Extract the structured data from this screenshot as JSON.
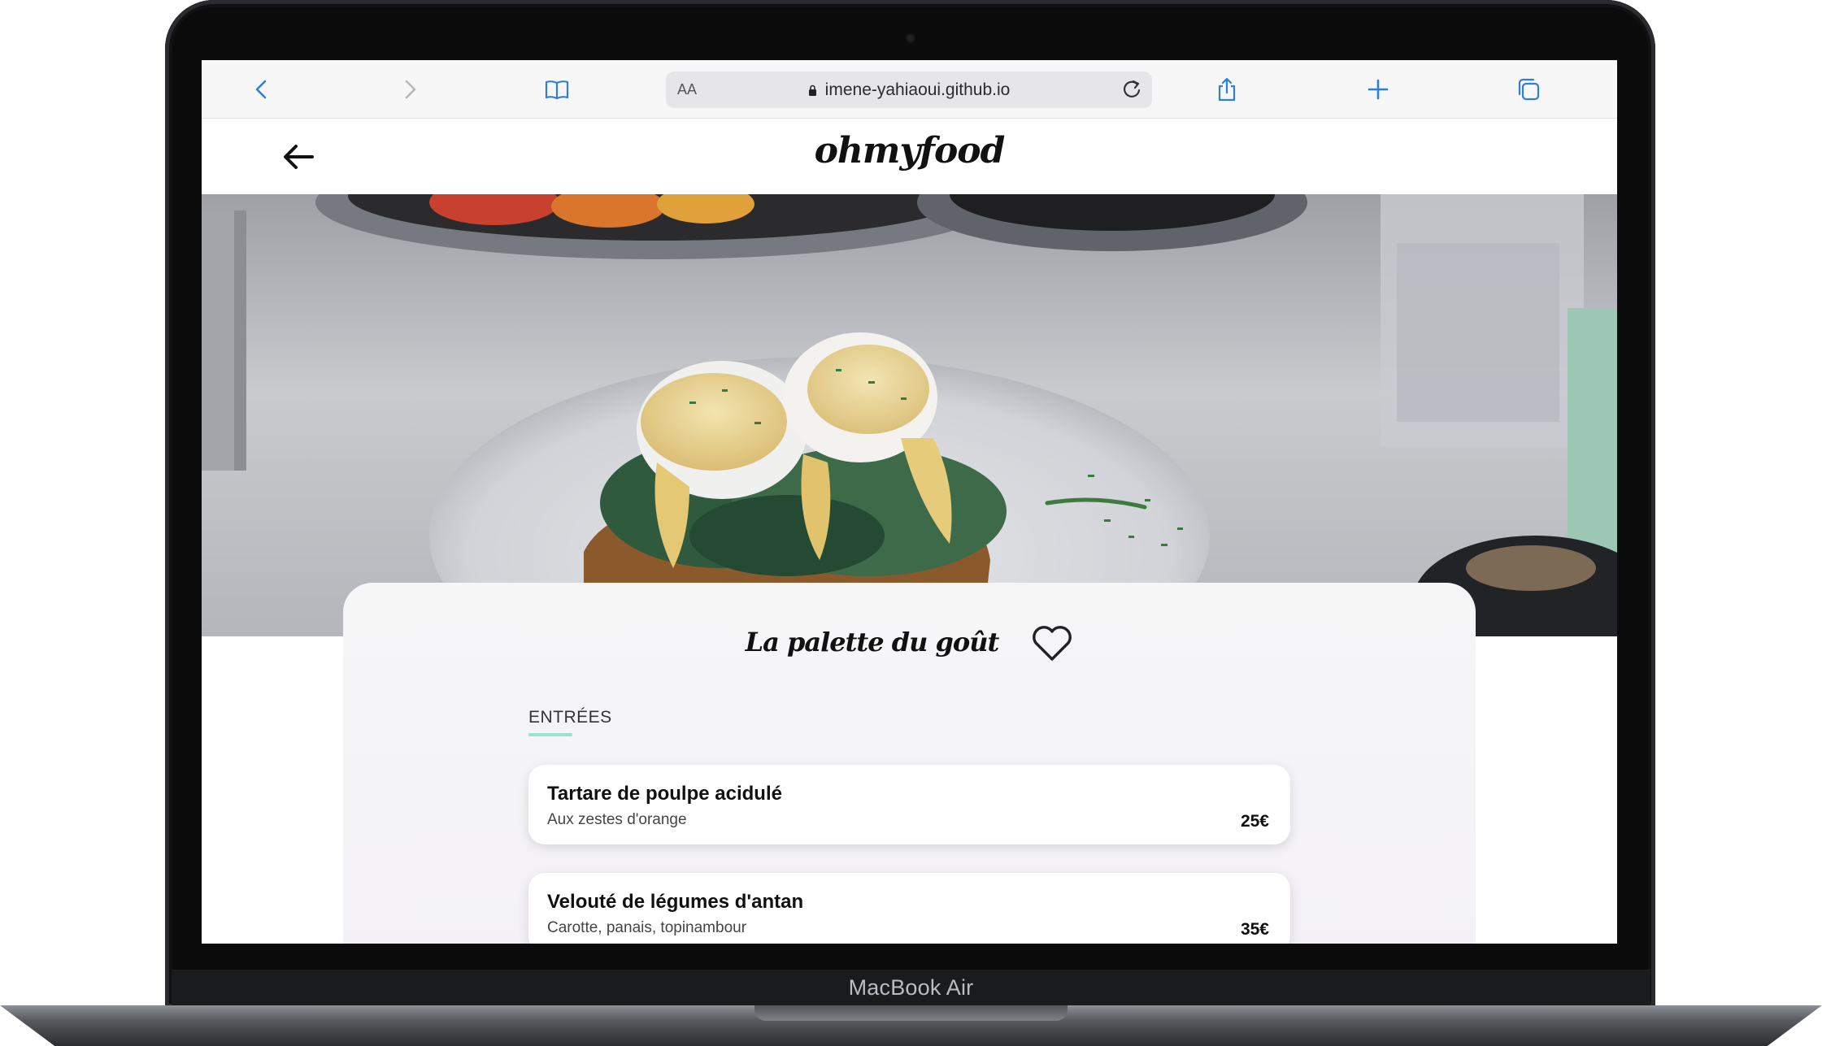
{
  "device": {
    "label": "MacBook Air"
  },
  "browser": {
    "address_aa": "AA",
    "url": "imene-yahiaoui.github.io",
    "icons": [
      "back-icon",
      "forward-icon",
      "bookmarks-icon",
      "lock-icon",
      "reload-icon",
      "share-icon",
      "new-tab-icon",
      "tabs-icon"
    ]
  },
  "site": {
    "logo": "ohmyfood",
    "back_icon": "arrow-left-icon"
  },
  "restaurant": {
    "name": "La palette du goût",
    "favorite_icon": "heart-icon"
  },
  "menu": {
    "section_title": "ENTRÉES",
    "dishes": [
      {
        "name": "Tartare de poulpe acidulé",
        "description": "Aux zestes d'orange",
        "price": "25€"
      },
      {
        "name": "Velouté de légumes d'antan",
        "description": "Carotte, panais, topinambour",
        "price": "35€"
      }
    ]
  },
  "colors": {
    "accent": "#99e2d0",
    "toolbar_icon": "#2f7fd8",
    "frame": "#0b0b0c"
  }
}
